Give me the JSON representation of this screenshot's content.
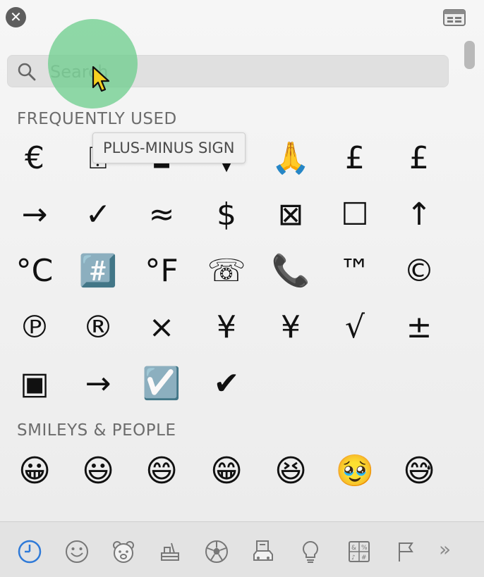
{
  "search": {
    "placeholder": "Search",
    "value": ""
  },
  "tooltip": {
    "text": "PLUS-MINUS SIGN"
  },
  "sections": [
    {
      "title": "FREQUENTLY USED",
      "symbols": [
        "€",
        "⍰",
        "▪",
        "▼",
        "🙏",
        "£",
        "£",
        "→",
        "✓",
        "≈",
        "$",
        "⊠",
        "☐",
        "↑",
        "°C",
        "#️⃣",
        "°F",
        "☏",
        "📞",
        "™",
        "©",
        "℗",
        "®",
        "×",
        "¥",
        "¥",
        "√",
        "±",
        "▣",
        "→",
        "☑️",
        "✔"
      ]
    },
    {
      "title": "SMILEYS & PEOPLE",
      "symbols": [
        "😀",
        "😃",
        "😄",
        "😁",
        "😆",
        "🥹",
        "😅"
      ]
    }
  ],
  "categories": [
    {
      "name": "recent",
      "active": true
    },
    {
      "name": "smileys",
      "active": false
    },
    {
      "name": "animals",
      "active": false
    },
    {
      "name": "food",
      "active": false
    },
    {
      "name": "activity",
      "active": false
    },
    {
      "name": "travel",
      "active": false
    },
    {
      "name": "objects",
      "active": false
    },
    {
      "name": "symbols",
      "active": false
    },
    {
      "name": "flags",
      "active": false
    }
  ],
  "more_label": "»",
  "colors": {
    "accent": "#2f7ad8",
    "touch": "#66cc88",
    "cursor": "#f5d020"
  }
}
